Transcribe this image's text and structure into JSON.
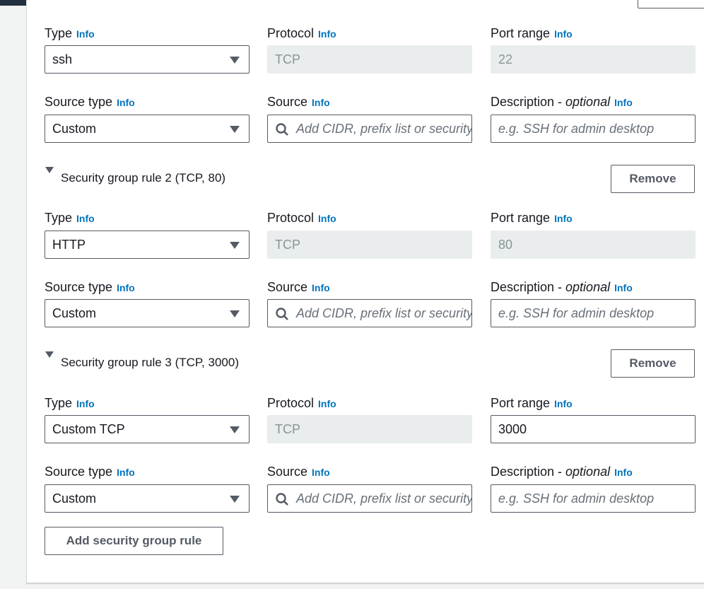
{
  "labels": {
    "type": "Type",
    "protocol": "Protocol",
    "port_range": "Port range",
    "source_type": "Source type",
    "source": "Source",
    "description": "Description - ",
    "optional": "optional",
    "info": "Info"
  },
  "rules": [
    {
      "header": "",
      "type": "ssh",
      "protocol": "TCP",
      "port_range": "22",
      "source_type": "Custom",
      "source_placeholder": "Add CIDR, prefix list or security",
      "description_placeholder": "e.g. SSH for admin desktop"
    },
    {
      "header": "Security group rule 2 (TCP, 80)",
      "type": "HTTP",
      "protocol": "TCP",
      "port_range": "80",
      "source_type": "Custom",
      "source_placeholder": "Add CIDR, prefix list or security",
      "description_placeholder": "e.g. SSH for admin desktop"
    },
    {
      "header": "Security group rule 3 (TCP, 3000)",
      "type": "Custom TCP",
      "protocol": "TCP",
      "port_range": "3000",
      "source_type": "Custom",
      "source_placeholder": "Add CIDR, prefix list or security",
      "description_placeholder": "e.g. SSH for admin desktop"
    }
  ],
  "remove_label": "Remove",
  "add_rule_label": "Add security group rule",
  "colors": {
    "info_link": "#0073bb",
    "border": "#545b64",
    "disabled_bg": "#eaeded"
  },
  "icons": [
    "search-icon",
    "caret-down-icon",
    "expand-triangle-icon"
  ]
}
